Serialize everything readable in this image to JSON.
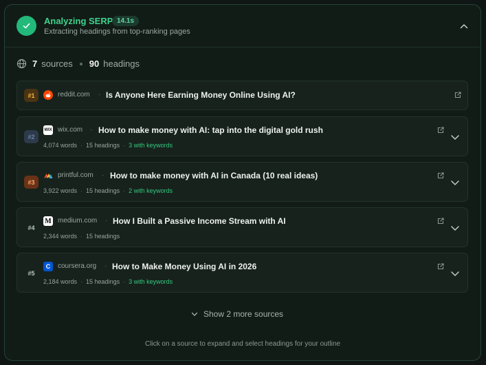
{
  "header": {
    "title": "Analyzing SERP",
    "time": "14.1s",
    "subtitle": "Extracting headings from top-ranking pages"
  },
  "summary": {
    "sources_count": "7",
    "sources_label": "sources",
    "headings_count": "90",
    "headings_label": "headings"
  },
  "sources": [
    {
      "rank": "#1",
      "domain": "reddit.com",
      "title": "Is Anyone Here Earning Money Online Using AI?"
    },
    {
      "rank": "#2",
      "domain": "wix.com",
      "favicon_text": "WIX",
      "title": "How to make money with AI: tap into the digital gold rush",
      "words": "4,074 words",
      "headings": "15 headings",
      "keywords": "3 with keywords"
    },
    {
      "rank": "#3",
      "domain": "printful.com",
      "title": "How to make money with AI in Canada (10 real ideas)",
      "words": "3,922 words",
      "headings": "15 headings",
      "keywords": "2 with keywords"
    },
    {
      "rank": "#4",
      "domain": "medium.com",
      "favicon_text": "M",
      "title": "How I Built a Passive Income Stream with AI",
      "words": "2,344 words",
      "headings": "15 headings"
    },
    {
      "rank": "#5",
      "domain": "coursera.org",
      "favicon_text": "C",
      "title": "How to Make Money Using AI in 2026",
      "words": "2,184 words",
      "headings": "15 headings",
      "keywords": "3 with keywords"
    }
  ],
  "show_more": "Show 2 more sources",
  "footer_hint": "Click on a source to expand and select headings for your outline",
  "colors": {
    "accent": "#22b97a",
    "keyword": "#35c87e",
    "panel_border": "#24443a"
  },
  "icons": {
    "status": "check-icon",
    "collapse": "chevron-up-icon",
    "globe": "globe-icon",
    "open": "external-link-icon",
    "expand": "chevron-down-icon"
  }
}
